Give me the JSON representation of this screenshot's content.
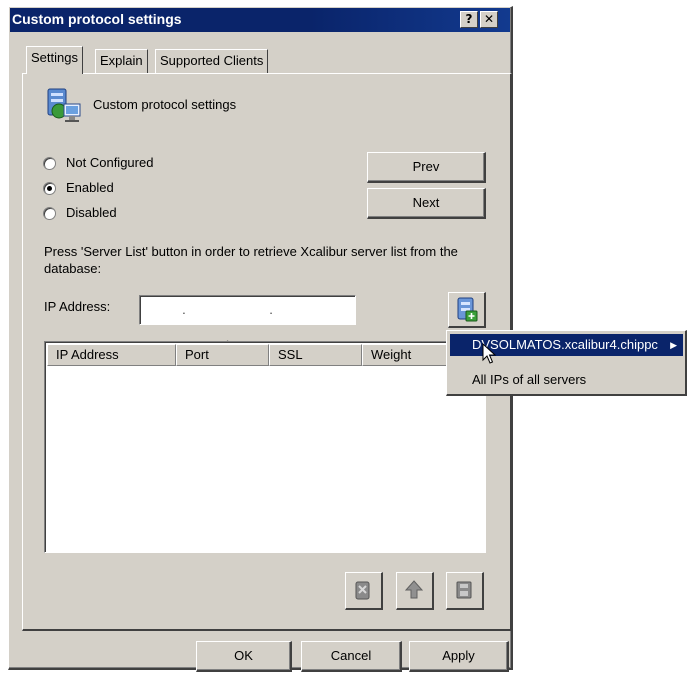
{
  "window": {
    "title": "Custom protocol settings",
    "help_glyph": "?",
    "close_glyph": "✕"
  },
  "tabs": [
    {
      "label": "Settings",
      "active": true
    },
    {
      "label": "Explain",
      "active": false
    },
    {
      "label": "Supported Clients",
      "active": false
    }
  ],
  "policy": {
    "heading": "Custom protocol settings",
    "icon": "server-network-icon"
  },
  "radios": [
    {
      "label": "Not Configured",
      "checked": false
    },
    {
      "label": "Enabled",
      "checked": true
    },
    {
      "label": "Disabled",
      "checked": false
    }
  ],
  "nav": {
    "prev_label": "Prev",
    "next_label": "Next"
  },
  "instruction": {
    "line1": "Press 'Server List' button in order to retrieve Xcalibur server list from the",
    "line2": "database:"
  },
  "ip_field": {
    "label": "IP Address:",
    "value": ". . ."
  },
  "server_list_button": {
    "icon": "server-list-icon"
  },
  "table": {
    "columns": [
      "IP Address",
      "Port",
      "SSL",
      "Weight"
    ],
    "rows": []
  },
  "context_menu": {
    "items": [
      {
        "label": "DVSOLMATOS.xcalibur4.chippc",
        "highlighted": true,
        "submenu": true
      },
      {
        "label": "All IPs of all servers",
        "highlighted": false,
        "submenu": false
      }
    ],
    "submenu_glyph": "▶"
  },
  "list_actions": {
    "remove_icon": "remove-icon",
    "up_icon": "arrow-up-icon",
    "down_icon": "disk-icon"
  },
  "dialog_buttons": {
    "ok": "OK",
    "cancel": "Cancel",
    "apply": "Apply"
  },
  "colors": {
    "title_bar": "#0a246a",
    "face": "#d4d0c8",
    "highlight": "#0a246a"
  }
}
